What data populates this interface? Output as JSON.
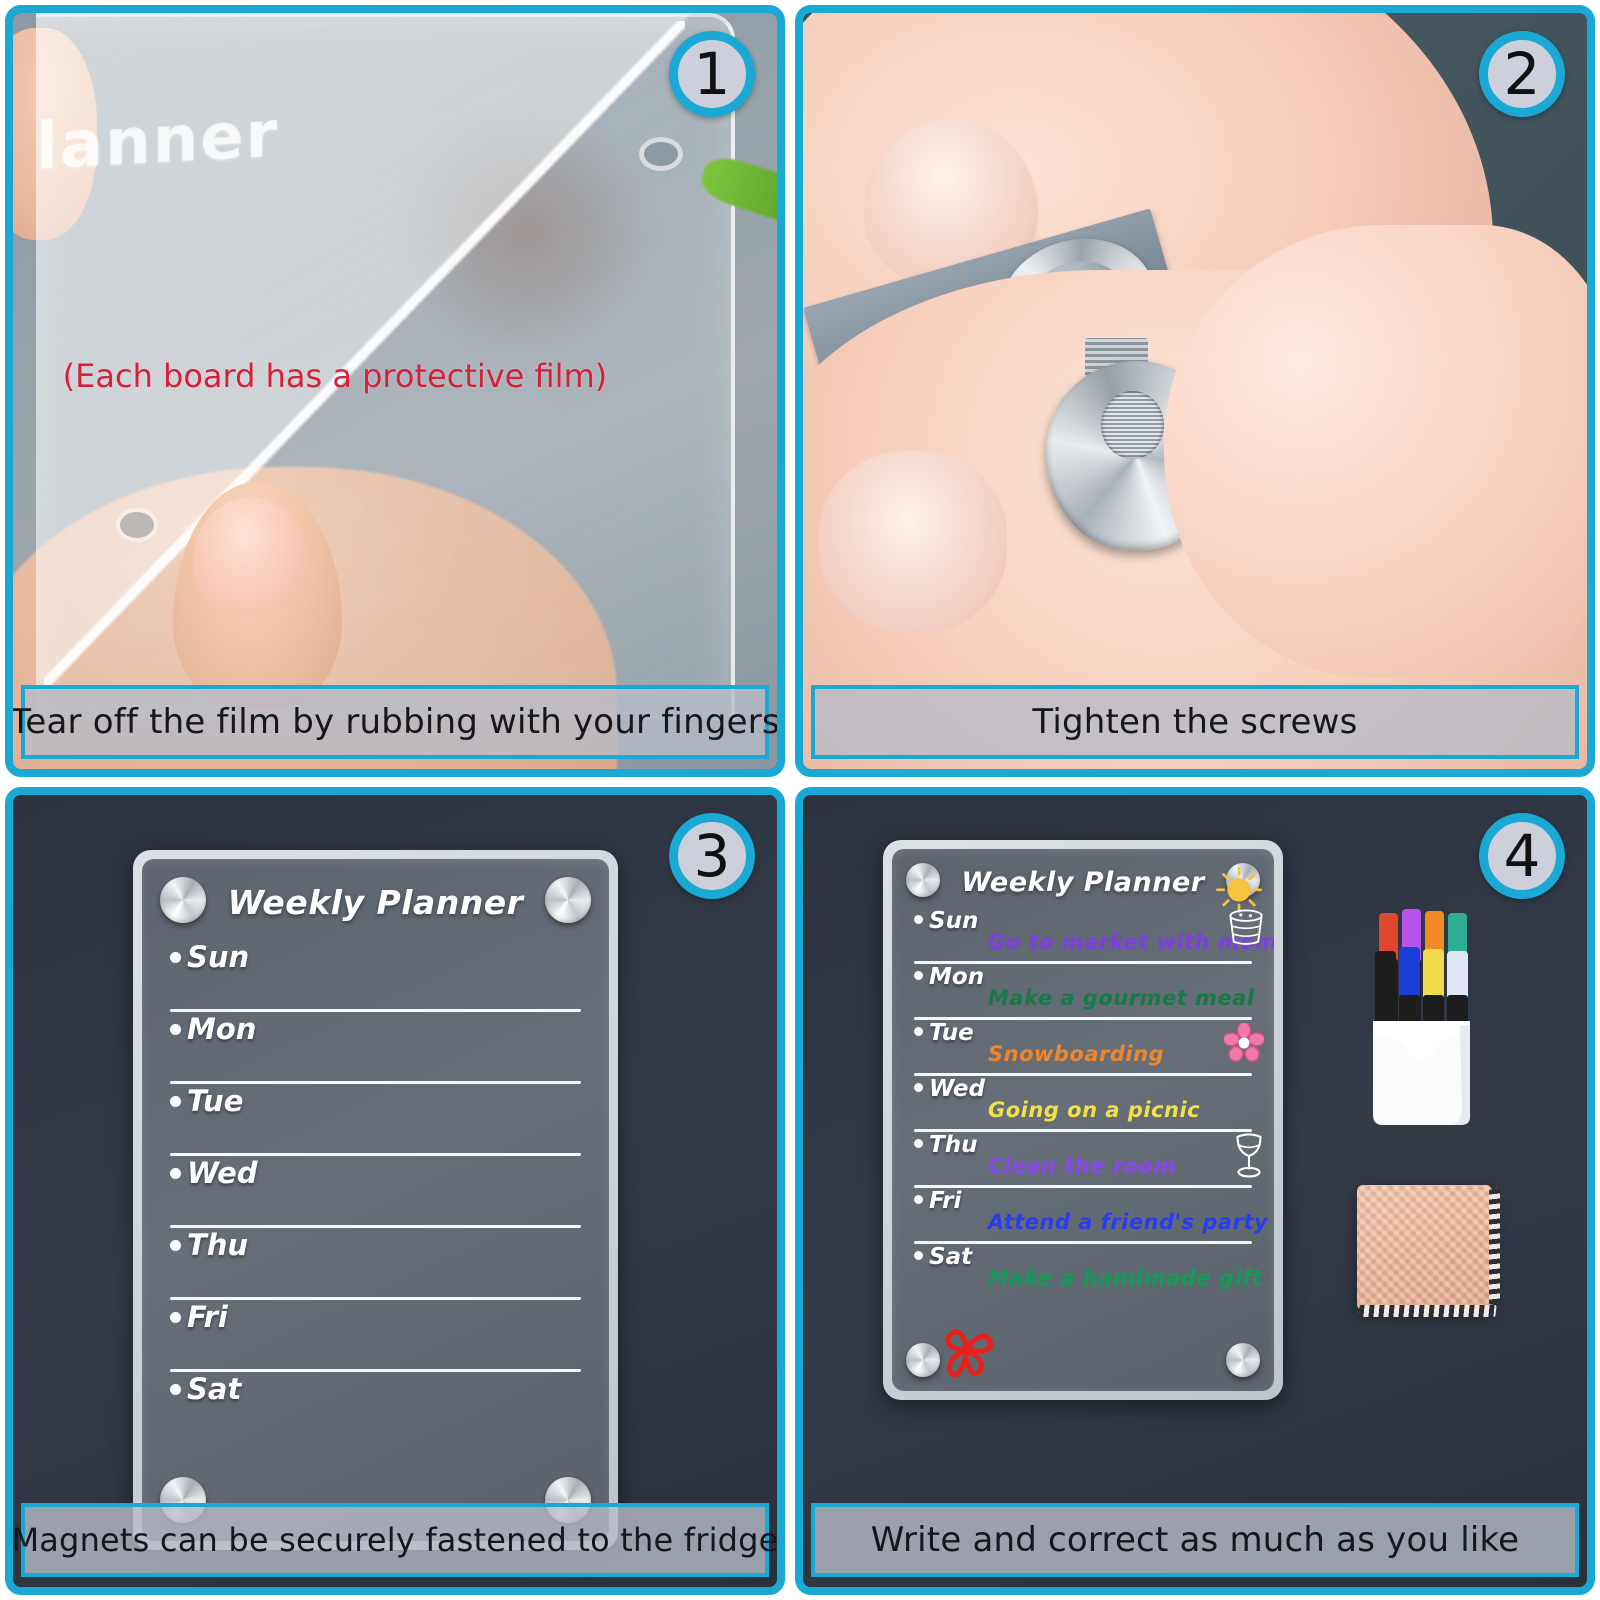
{
  "theme": {
    "accent_cyan": "#1aa8d4",
    "dark_background": "#2e3542",
    "caption_background": "#b7bcc7",
    "board_face": "#5d656f"
  },
  "panels": [
    {
      "number": "1",
      "caption": "Tear off the film by rubbing with your fingers",
      "overlay_note": "(Each board has a protective film)",
      "board_word": "lanner",
      "note_color": "#d81f3a"
    },
    {
      "number": "2",
      "caption": "Tighten the screws"
    },
    {
      "number": "3",
      "caption": "Magnets can be securely fastened to the fridge",
      "board": {
        "title": "Weekly Planner",
        "days": [
          "Sun",
          "Mon",
          "Tue",
          "Wed",
          "Thu",
          "Fri",
          "Sat"
        ]
      }
    },
    {
      "number": "4",
      "caption": "Write and correct as much as you like",
      "board": {
        "title": "Weekly Planner",
        "days": [
          "Sun",
          "Mon",
          "Tue",
          "Wed",
          "Thu",
          "Fri",
          "Sat"
        ],
        "entries": [
          {
            "day": "Sun",
            "text": "Go to market with mom",
            "color": "#7b3fe4",
            "icon": "sun-icon"
          },
          {
            "day": "Mon",
            "text": "Make a gourmet meal",
            "color": "#187a4a",
            "icon": "basket-icon"
          },
          {
            "day": "Tue",
            "text": "Snowboarding",
            "color": "#f0862a",
            "icon": ""
          },
          {
            "day": "Wed",
            "text": "Going on a picnic",
            "color": "#f2e04a",
            "icon": "flower-icon"
          },
          {
            "day": "Thu",
            "text": "Clean the room",
            "color": "#8b46f0",
            "icon": ""
          },
          {
            "day": "Fri",
            "text": "Attend a friend's party",
            "color": "#2a3cf0",
            "icon": "wine-glass-icon"
          },
          {
            "day": "Sat",
            "text": "Make a handmade gift",
            "color": "#149b5a",
            "icon": ""
          }
        ],
        "doodle": "red-flower-doodle",
        "doodle_color": "#e8201c"
      },
      "accessories": {
        "pen_holder": "white-pen-holder",
        "pen_colors_back": [
          "#e0472e",
          "#b654e8",
          "#f08a23",
          "#2fae93"
        ],
        "pen_colors_front": [
          "#1d1d1d",
          "#1b3fd6",
          "#f0dc4a",
          "#dfe6f5"
        ],
        "cloth": "microfiber-cleaning-cloth",
        "cloth_color": "#edb294"
      }
    }
  ]
}
